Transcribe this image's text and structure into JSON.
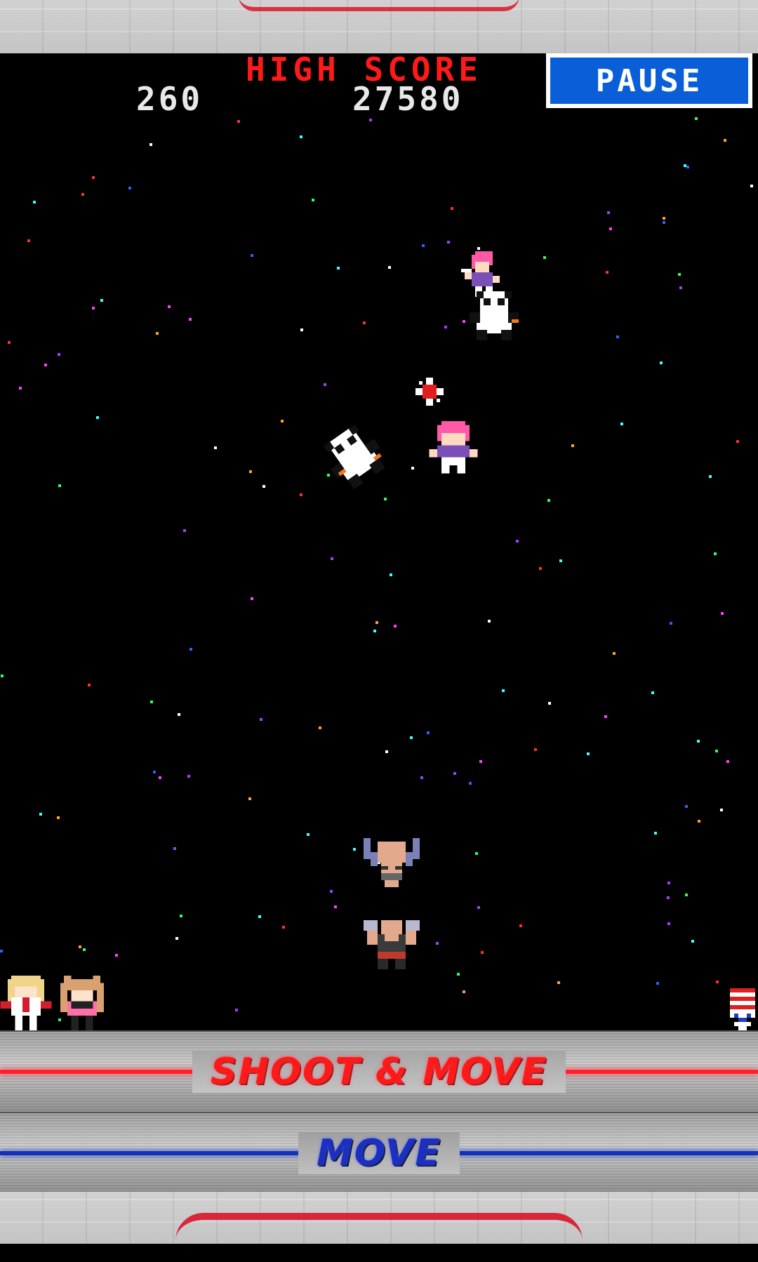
{
  "hud": {
    "high_score_label": "HIGH SCORE",
    "score": "260",
    "high_score": "27580",
    "pause_label": "PAUSE"
  },
  "controls": {
    "shoot_move_label": "SHOOT & MOVE",
    "move_label": "MOVE"
  },
  "sprites": {
    "enemies": [
      "pink-haired-girl-enemy",
      "panda-enemy",
      "panda-enemy-diving",
      "pink-haired-girl-enemy-2"
    ],
    "player": "player-fighter",
    "player_lives": [
      "life-icon-blonde-girl",
      "life-icon-pink-girl"
    ],
    "stage_flag": "stage-flag-icon"
  },
  "colors": {
    "high_score_label": "#ff1a1a",
    "pause_button": "#0a5fd8",
    "shoot_line": "#ff1f2e",
    "move_line": "#1630b8"
  }
}
